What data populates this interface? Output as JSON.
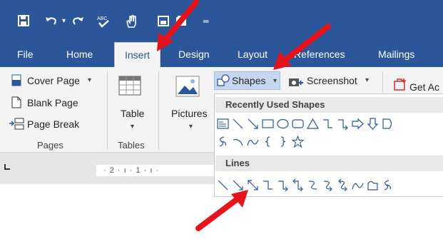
{
  "tabs": {
    "file": "File",
    "home": "Home",
    "insert": "Insert",
    "design": "Design",
    "layout": "Layout",
    "references": "References",
    "mailings": "Mailings"
  },
  "ribbon": {
    "pages_group": {
      "cover_page": "Cover Page",
      "blank_page": "Blank Page",
      "page_break": "Page Break",
      "label": "Pages"
    },
    "tables_group": {
      "table": "Table",
      "label": "Tables"
    },
    "pictures": "Pictures",
    "shapes": "Shapes",
    "screenshot": "Screenshot",
    "get_addins": "Get Ac"
  },
  "ruler": {
    "text": "· 2 · ı · 1 · ı ·"
  },
  "shapes_panel": {
    "recently_used_header": "Recently Used Shapes",
    "lines_header": "Lines"
  },
  "colors": {
    "brand": "#2b579a",
    "ribbon_bg": "#f3f3f3",
    "arrow": "#e8121b"
  }
}
